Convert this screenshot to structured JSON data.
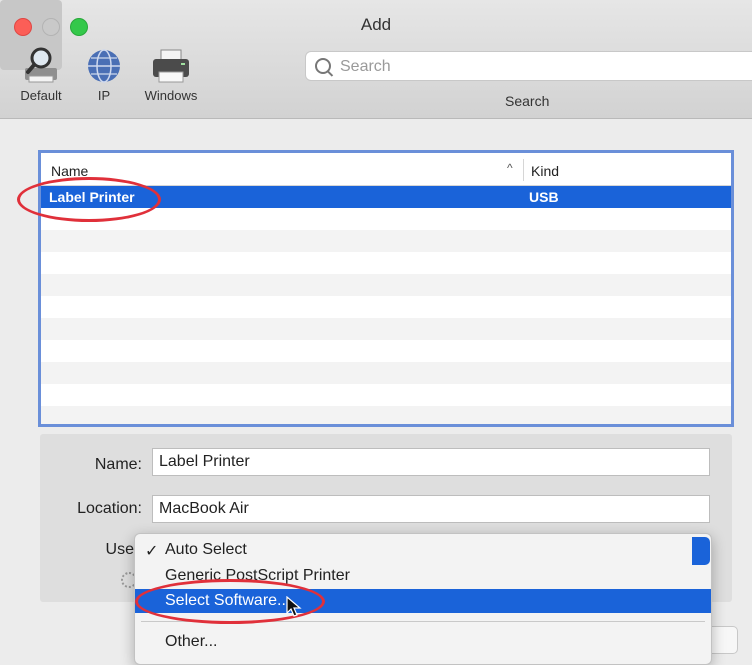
{
  "window": {
    "title": "Add"
  },
  "toolbar": {
    "default_label": "Default",
    "ip_label": "IP",
    "windows_label": "Windows",
    "search_placeholder": "Search",
    "search_caption": "Search"
  },
  "list": {
    "columns": {
      "name": "Name",
      "kind": "Kind"
    },
    "sort_indicator": "^",
    "rows": [
      {
        "name": "Label Printer",
        "kind": "USB",
        "selected": true
      }
    ]
  },
  "form": {
    "name_label": "Name:",
    "name_value": "Label Printer",
    "location_label": "Location:",
    "location_value": "MacBook Air",
    "use_label": "Use"
  },
  "use_menu": {
    "items": [
      {
        "label": "Auto Select",
        "checked": true
      },
      {
        "label": "Generic PostScript Printer"
      },
      {
        "label": "Select Software...",
        "highlighted": true
      },
      {
        "label": "Other..."
      }
    ]
  },
  "colors": {
    "selection": "#1a63d9",
    "annotation": "#e0303a",
    "list_border": "#6a8fd9"
  }
}
